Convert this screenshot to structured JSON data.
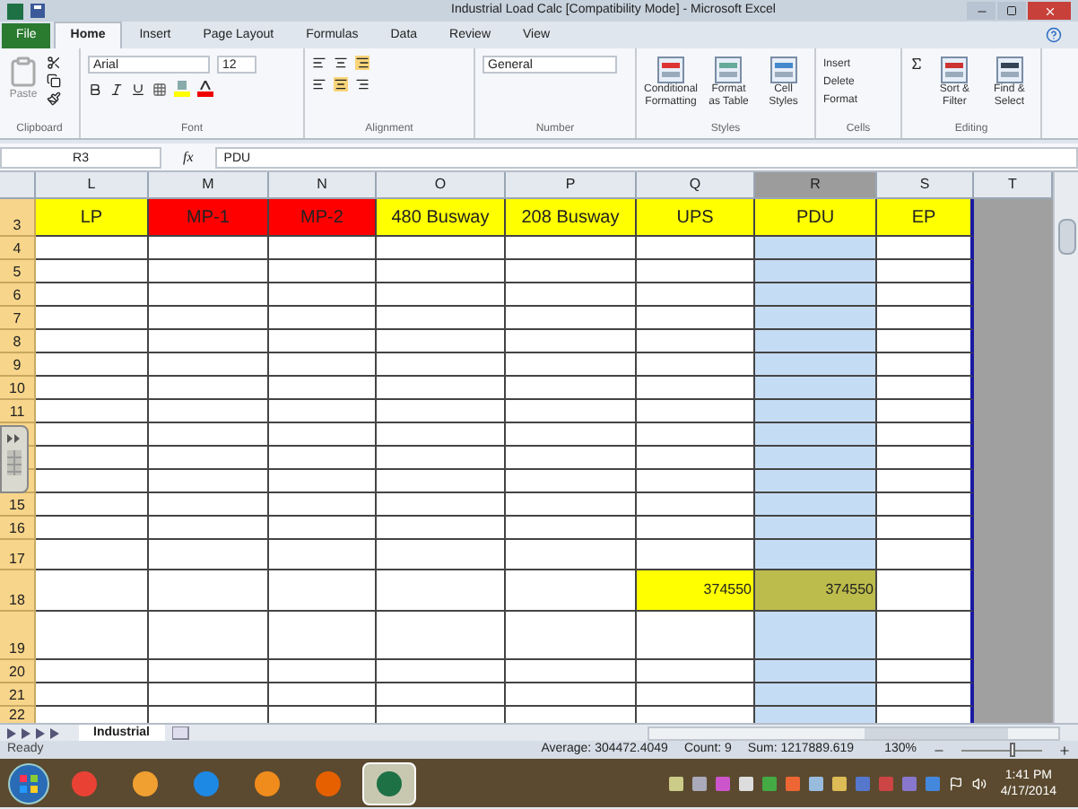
{
  "window": {
    "title": "Industrial Load Calc  [Compatibility Mode] - Microsoft Excel"
  },
  "ribbon_tabs": [
    {
      "label": "File",
      "kind": "file",
      "selected": false
    },
    {
      "label": "Home",
      "kind": "tab",
      "selected": true
    },
    {
      "label": "Insert",
      "kind": "tab",
      "selected": false
    },
    {
      "label": "Page Layout",
      "kind": "tab",
      "selected": false
    },
    {
      "label": "Formulas",
      "kind": "tab",
      "selected": false
    },
    {
      "label": "Data",
      "kind": "tab",
      "selected": false
    },
    {
      "label": "Review",
      "kind": "tab",
      "selected": false
    },
    {
      "label": "View",
      "kind": "tab",
      "selected": false
    }
  ],
  "ribbon": {
    "paste": "Paste",
    "font_name": "Arial",
    "font_size": "12",
    "number_format": "General",
    "styles": [
      "Conditional Formatting",
      "Format as Table",
      "Cell Styles"
    ],
    "cells": [
      "Insert",
      "Delete",
      "Format"
    ],
    "editing": [
      "Sort & Filter",
      "Find & Select"
    ],
    "groups": [
      "Clipboard",
      "Font",
      "Alignment",
      "Number",
      "Styles",
      "Cells",
      "Editing"
    ]
  },
  "formula_bar": {
    "name_box": "R3",
    "function_label": "fx",
    "formula": "PDU"
  },
  "sheet": {
    "columns": [
      {
        "label": "L",
        "selected": false
      },
      {
        "label": "M",
        "selected": false
      },
      {
        "label": "N",
        "selected": false
      },
      {
        "label": "O",
        "selected": false
      },
      {
        "label": "P",
        "selected": false
      },
      {
        "label": "Q",
        "selected": false
      },
      {
        "label": "R",
        "selected": true
      },
      {
        "label": "S",
        "selected": false
      },
      {
        "label": "T",
        "selected": false
      }
    ],
    "rows": [
      {
        "header": "3",
        "cells": [
          {
            "text": "LP",
            "color": "#ffff00"
          },
          {
            "text": "MP-1",
            "color": "#ff0000"
          },
          {
            "text": "MP-2",
            "color": "#ff0000"
          },
          {
            "text": "480 Busway",
            "color": "#ffff00"
          },
          {
            "text": "208 Busway",
            "color": "#ffff00"
          },
          {
            "text": "UPS",
            "color": "#ffff00"
          },
          {
            "text": "PDU",
            "color": "#ffff00"
          },
          {
            "text": "EP",
            "color": "#ffff00"
          }
        ]
      },
      {
        "header": "4"
      },
      {
        "header": "5"
      },
      {
        "header": "6"
      },
      {
        "header": "7"
      },
      {
        "header": "8"
      },
      {
        "header": "9"
      },
      {
        "header": "10"
      },
      {
        "header": "11"
      },
      {},
      {},
      {},
      {
        "header": "15"
      },
      {
        "header": "16"
      },
      {
        "header": "17"
      },
      {
        "header": "18",
        "cells": [
          {},
          {},
          {},
          {},
          {},
          {
            "text": "374550",
            "color": "#ffff00",
            "numeric": true
          },
          {
            "text": "374550",
            "color": "#bcbc4c",
            "numeric": true
          },
          {}
        ]
      },
      {
        "header": "19"
      },
      {
        "header": "20"
      },
      {
        "header": "21"
      },
      {
        "header": "22"
      }
    ]
  },
  "sheet_tabs": [
    {
      "label": "Industrial",
      "selected": true
    }
  ],
  "status_bar": {
    "mode": "Ready",
    "average": "Average: 304472.4049",
    "count": "Count: 9",
    "sum": "Sum: 1217889.619",
    "zoom": "130%",
    "zoom_slider": {
      "level": 0.6
    }
  },
  "taskbar": {
    "apps": [
      {
        "selected": false
      },
      {
        "selected": false
      },
      {
        "selected": false
      },
      {
        "selected": false
      },
      {
        "selected": false
      },
      {
        "selected": true
      }
    ],
    "time": "1:41 PM",
    "date": "4/17/2014"
  }
}
